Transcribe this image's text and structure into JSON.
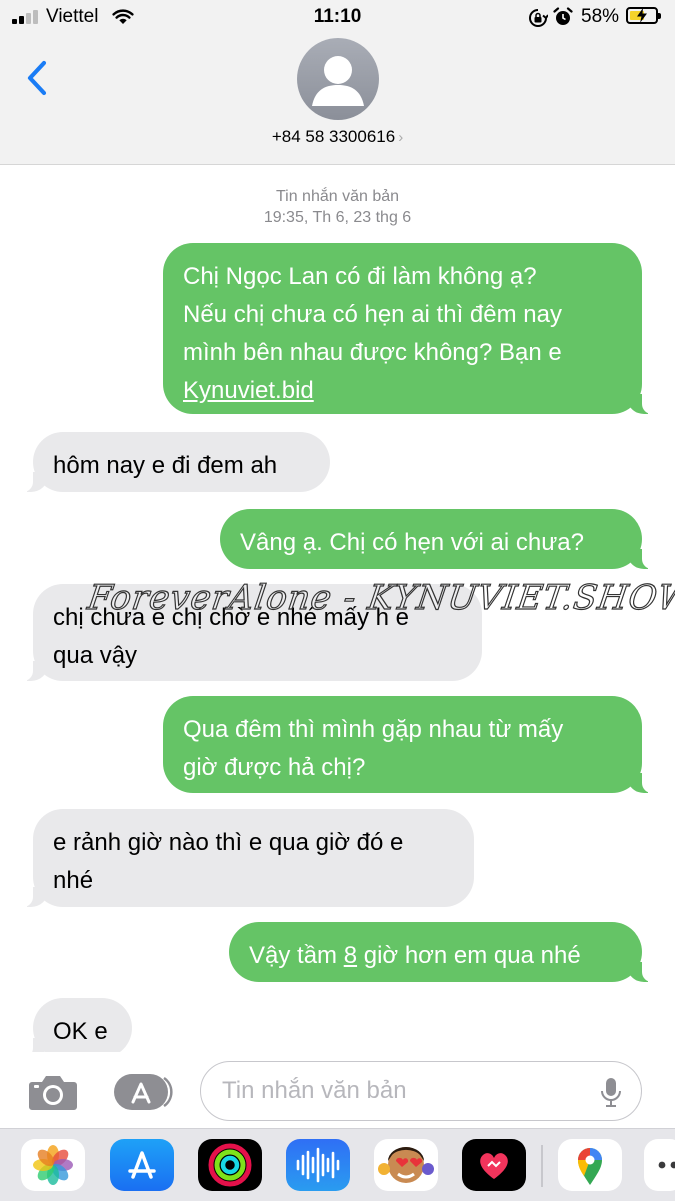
{
  "status_bar": {
    "carrier": "Viettel",
    "time": "11:10",
    "battery_percent": "58%",
    "battery_level": 0.58,
    "icons": [
      "signal-icon",
      "wifi-icon",
      "orientation-lock-icon",
      "alarm-icon",
      "battery-charging-icon"
    ]
  },
  "header": {
    "contact": "+84 58 3300616",
    "back_icon": "chevron-left-icon",
    "avatar_icon": "person-icon"
  },
  "conversation": {
    "service_label": "Tin nhắn văn bản",
    "timestamp": "19:35, Th 6, 23 thg 6",
    "messages": [
      {
        "direction": "out",
        "text": "Chị Ngọc Lan có đi làm không ạ?\nNếu chị chưa có hẹn ai thì đêm nay\nmình bên nhau được không? Bạn e\n",
        "link": "Kynuviet.bid"
      },
      {
        "direction": "in",
        "text": "hôm nay e đi đem ah"
      },
      {
        "direction": "out",
        "text": "Vâng ạ. Chị có hẹn với ai chưa?"
      },
      {
        "direction": "in",
        "text": "chị chưa e chị chờ e nhé mấy h e\nqua vậy"
      },
      {
        "direction": "out",
        "text": "Qua đêm thì mình gặp nhau từ mấy\ngiờ được hả chị?"
      },
      {
        "direction": "in",
        "text": "e rảnh giờ nào thì e qua giờ đó e\nnhé"
      },
      {
        "direction": "out",
        "text_before": "Vậy tầm ",
        "text_underlined": "8",
        "text_after": " giờ hơn em qua nhé"
      },
      {
        "direction": "in",
        "text": "OK e"
      }
    ]
  },
  "watermark": "ForeverAlone - KYNUVIET.SHOW",
  "compose": {
    "placeholder": "Tin nhắn văn bản",
    "value": ""
  },
  "app_drawer": {
    "apps": [
      "photos-icon",
      "app-store-icon",
      "activity-icon",
      "voice-memos-icon",
      "memoji-stickers-icon",
      "digital-touch-icon",
      "google-maps-icon",
      "more-apps-icon"
    ]
  },
  "colors": {
    "outgoing_bubble": "#65c466",
    "incoming_bubble": "#e9e9eb",
    "accent": "#1a7cf5"
  }
}
